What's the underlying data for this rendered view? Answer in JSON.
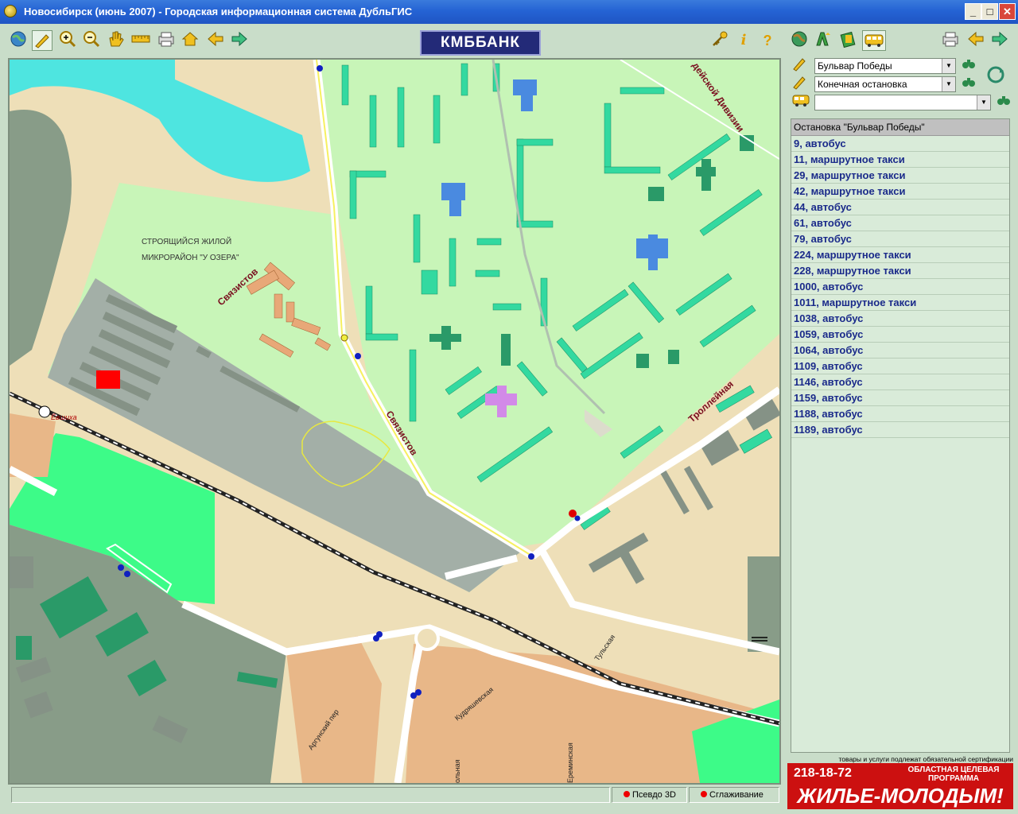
{
  "window": {
    "title": "Новосибирск (июнь 2007) - Городская информационная система ДубльГИС",
    "minimize": "_",
    "maximize": "□",
    "close": "✕"
  },
  "toolbar": {
    "logo_text": "КМББАНК",
    "left_icons": [
      "globe-icon",
      "pen-icon",
      "zoom-in-icon",
      "zoom-out-icon",
      "hand-icon",
      "ruler-icon",
      "print-icon",
      "home-icon",
      "back-icon",
      "forward-icon"
    ],
    "right_icons": [
      "key-icon",
      "info-icon",
      "help-icon",
      "globe-search-icon",
      "find-address-icon",
      "find-org-icon",
      "bus-icon",
      "print-icon",
      "back-icon",
      "forward-icon"
    ]
  },
  "map": {
    "labels": {
      "district": "СТРОЯЩИЙСЯ ЖИЛОЙ",
      "district2": "МИКРОРАЙОН \"У ОЗЕРА\"",
      "street_svyazistov_1": "Связистов",
      "street_svyazistov_2": "Связистов",
      "street_trolleynaya": "Троллейная",
      "street_division": "дейской Дивизии",
      "station": "Ёвшиха",
      "street_tulskaya": "Тульская",
      "street_kudryashovskaya": "Кудряшевская",
      "street_argunsky": "Аргунский пер",
      "street_ereminskaya": "Ереминская",
      "street_olnaya": "ольная"
    },
    "colors": {
      "water": "#4ee5e0",
      "residential": "#c8f5b8",
      "building": "#33d9a0",
      "park": "#3dfb88",
      "industrial": "#a3afa7",
      "sand": "#eedfb8",
      "private": "#e8b788",
      "forest": "#889c88"
    }
  },
  "status": {
    "main": "",
    "pseudo3d": "Псевдо 3D",
    "smoothing": "Сглаживание"
  },
  "route": {
    "from": "Бульвар Победы",
    "to": "Конечная остановка",
    "transport": ""
  },
  "stops": {
    "header": "Остановка \"Бульвар Победы\"",
    "items": [
      "9, автобус",
      "11, маршрутное такси",
      "29, маршрутное такси",
      "42, маршрутное такси",
      "44, автобус",
      "61, автобус",
      "79, автобус",
      "224, маршрутное такси",
      "228, маршрутное такси",
      "1000, автобус",
      "1011, маршрутное такси",
      "1038, автобус",
      "1059, автобус",
      "1064, автобус",
      "1109, автобус",
      "1146, автобус",
      "1159, автобус",
      "1188, автобус",
      "1189, автобус"
    ]
  },
  "ad": {
    "cert": "товары и услуги подлежат обязательной сертификации",
    "phone": "218-18-72",
    "program": "ОБЛАСТНАЯ ЦЕЛЕВАЯ ПРОГРАММА",
    "slogan": "ЖИЛЬЕ-МОЛОДЫМ!"
  }
}
